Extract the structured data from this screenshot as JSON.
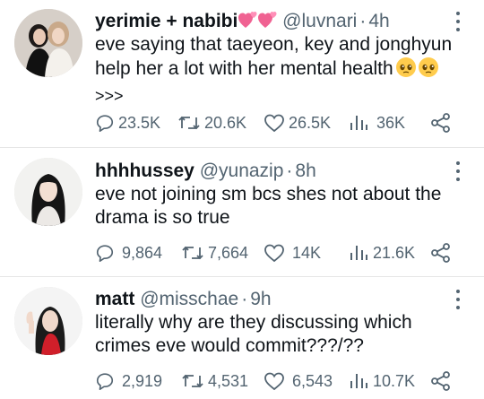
{
  "tweets": [
    {
      "name": "yerimie + nabibi",
      "name_emoji": "revolving-hearts-emoji",
      "handle": "@luvnari",
      "separator": "·",
      "time": "4h",
      "text": "eve saying that taeyeon, key and jonghyun help her a lot with her mental health",
      "text_emoji": "pleading-face-emoji",
      "continuation": ">>>",
      "replies": "23.5K",
      "retweets": "20.6K",
      "likes": "26.5K",
      "views": "36K"
    },
    {
      "name": "hhhhussey",
      "handle": "@yunazip",
      "separator": "·",
      "time": "8h",
      "text": "eve not joining sm bcs shes not about the drama is so true",
      "replies": "9,864",
      "retweets": "7,664",
      "likes": "14K",
      "views": "21.6K"
    },
    {
      "name": "matt",
      "handle": "@misschae",
      "separator": "·",
      "time": "9h",
      "text": "literally why are they discussing which crimes eve would commit???/??",
      "replies": "2,919",
      "retweets": "4,531",
      "likes": "6,543",
      "views": "10.7K"
    }
  ],
  "colors": {
    "text": "#0f1419",
    "secondary": "#536471",
    "divider": "#e6e6e6",
    "heart_emoji": "#f06292"
  }
}
